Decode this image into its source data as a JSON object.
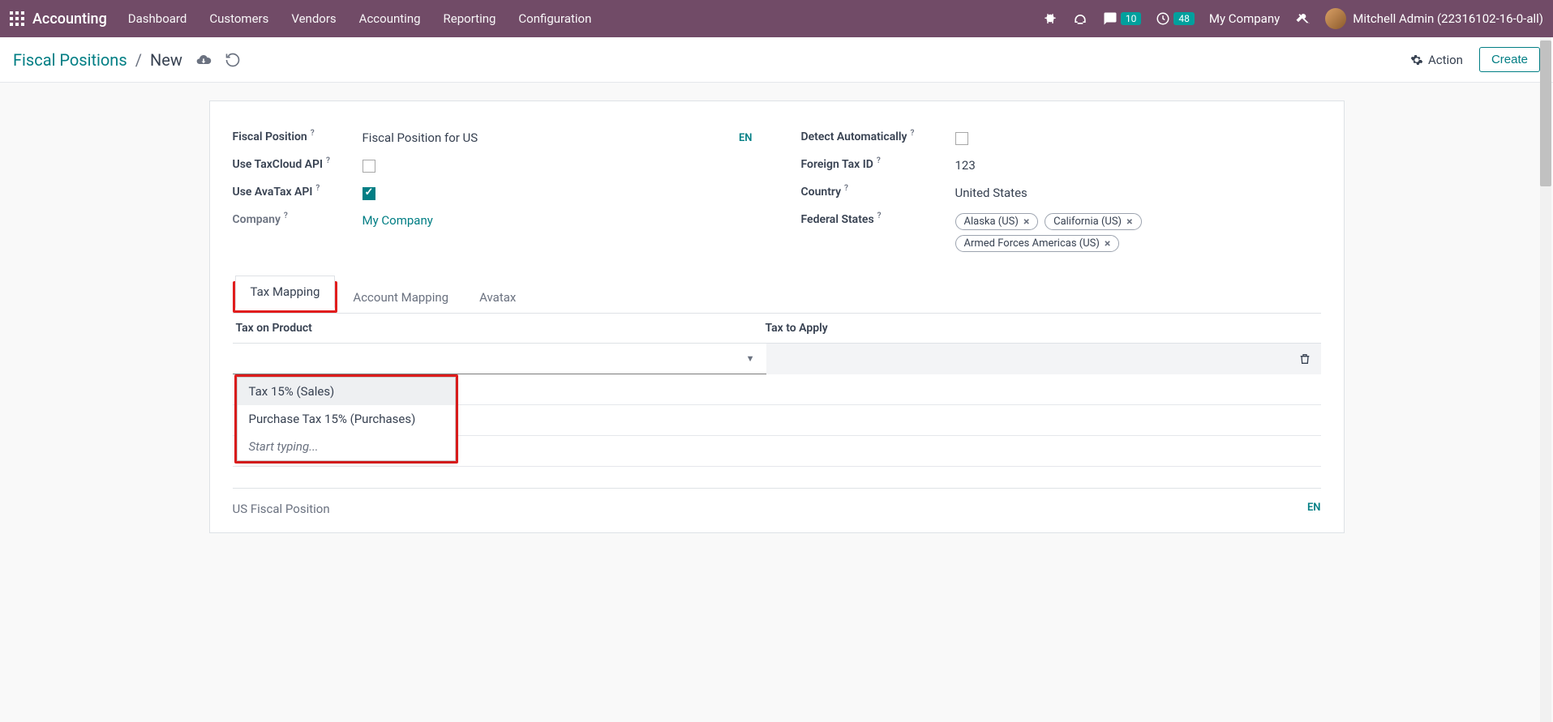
{
  "topbar": {
    "brand": "Accounting",
    "nav": [
      "Dashboard",
      "Customers",
      "Vendors",
      "Accounting",
      "Reporting",
      "Configuration"
    ],
    "messages_badge": "10",
    "activities_badge": "48",
    "company": "My Company",
    "user": "Mitchell Admin (22316102-16-0-all)"
  },
  "actionbar": {
    "breadcrumb_root": "Fiscal Positions",
    "breadcrumb_current": "New",
    "action_label": "Action",
    "create_label": "Create"
  },
  "form": {
    "left": {
      "fiscal_position_label": "Fiscal Position",
      "fiscal_position_value": "Fiscal Position for US",
      "lang_tag": "EN",
      "taxcloud_label": "Use TaxCloud API",
      "avatax_label": "Use AvaTax API",
      "company_label": "Company",
      "company_value": "My Company"
    },
    "right": {
      "detect_label": "Detect Automatically",
      "foreign_tax_label": "Foreign Tax ID",
      "foreign_tax_value": "123",
      "country_label": "Country",
      "country_value": "United States",
      "states_label": "Federal States",
      "states": [
        "Alaska (US)",
        "California (US)",
        "Armed Forces Americas (US)"
      ]
    }
  },
  "tabs": [
    "Tax Mapping",
    "Account Mapping",
    "Avatax"
  ],
  "table": {
    "col1": "Tax on Product",
    "col2": "Tax to Apply"
  },
  "dropdown": {
    "opt1": "Tax 15% (Sales)",
    "opt2": "Purchase Tax 15% (Purchases)",
    "opt3": "Start typing..."
  },
  "footer": {
    "note": "US Fiscal Position",
    "lang": "EN"
  }
}
